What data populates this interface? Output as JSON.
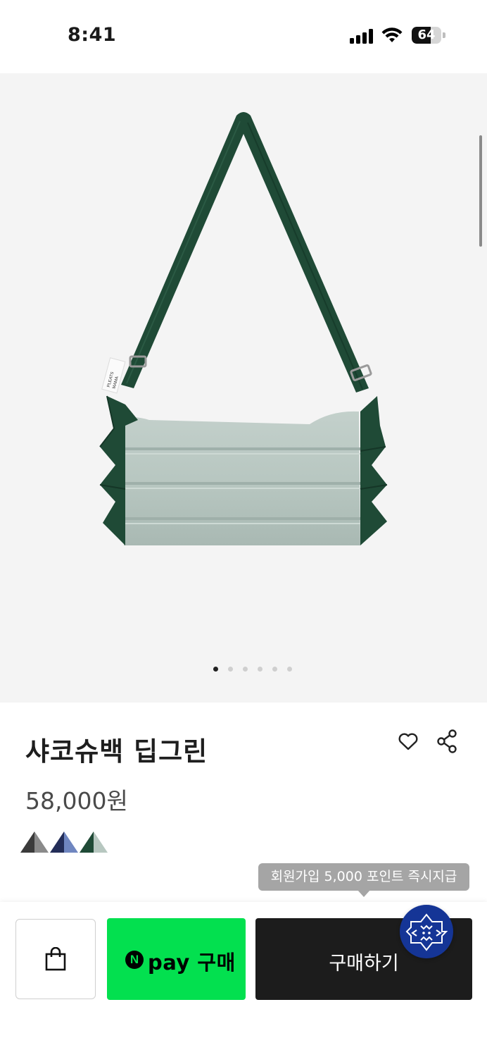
{
  "status_bar": {
    "time": "8:41",
    "battery_level": "64",
    "icons": [
      "signal-icon",
      "wifi-icon",
      "battery-icon"
    ]
  },
  "gallery": {
    "image": "bag-product-image",
    "slide_count": 6,
    "active_slide": 1,
    "brand_tag_text": "PLEATS MAMA"
  },
  "product": {
    "title": "샤코슈백 딥그린",
    "price": "58,000원",
    "color_swatches": [
      {
        "name": "charcoal",
        "left": "#3b3b3b",
        "right": "#8a8a8a"
      },
      {
        "name": "navy",
        "left": "#232d58",
        "right": "#6f86c0"
      },
      {
        "name": "deep-green",
        "left": "#1f4a36",
        "right": "#b7c7c0"
      }
    ]
  },
  "actions": {
    "heart_icon": "heart-icon",
    "share_icon": "share-icon",
    "tooltip": "회원가입 5,000 포인트 즉시지급",
    "cart_icon": "shopping-bag-icon",
    "npay_logo_letter": "N",
    "npay_label": "pay 구매",
    "buy_label": "구매하기",
    "chat_icon": "chat-face-icon"
  },
  "colors": {
    "npay_green": "#03e04f",
    "buy_black": "#1c1c1c",
    "chat_blue": "#153596",
    "tooltip_gray": "#a5a5a5",
    "hero_bg": "#f4f4f4"
  }
}
